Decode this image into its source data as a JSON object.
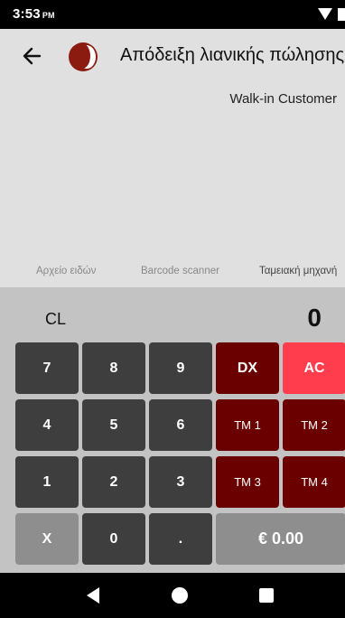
{
  "status_bar": {
    "time": "3:53",
    "ampm": "PM"
  },
  "app_bar": {
    "title": "Απόδειξη λιανικής πώλησης"
  },
  "customer": "Walk-in Customer",
  "tabs": [
    "Αρχείο ειδών",
    "Barcode scanner",
    "Ταμειακή μηχανή"
  ],
  "keypad": {
    "clear_label": "CL",
    "display_value": "0",
    "keys": {
      "seven": "7",
      "eight": "8",
      "nine": "9",
      "dx": "DX",
      "ac": "AC",
      "four": "4",
      "five": "5",
      "six": "6",
      "tm1": "TM 1",
      "tm2": "TM 2",
      "one": "1",
      "two": "2",
      "three": "3",
      "tm3": "TM 3",
      "tm4": "TM 4",
      "x": "X",
      "zero": "0",
      "dot": ".",
      "total": "€ 0.00"
    }
  },
  "icons": {
    "back": "arrow-left-icon",
    "logo": "app-logo",
    "nav_back": "triangle-back-icon",
    "nav_home": "circle-home-icon",
    "nav_recent": "square-recents-icon"
  },
  "colors": {
    "dark_key": "#3e3e3e",
    "grey_key": "#8e8e8e",
    "red_key": "#6b0000",
    "ac_key": "#ff3d4d",
    "logo": "#8b1a10"
  }
}
